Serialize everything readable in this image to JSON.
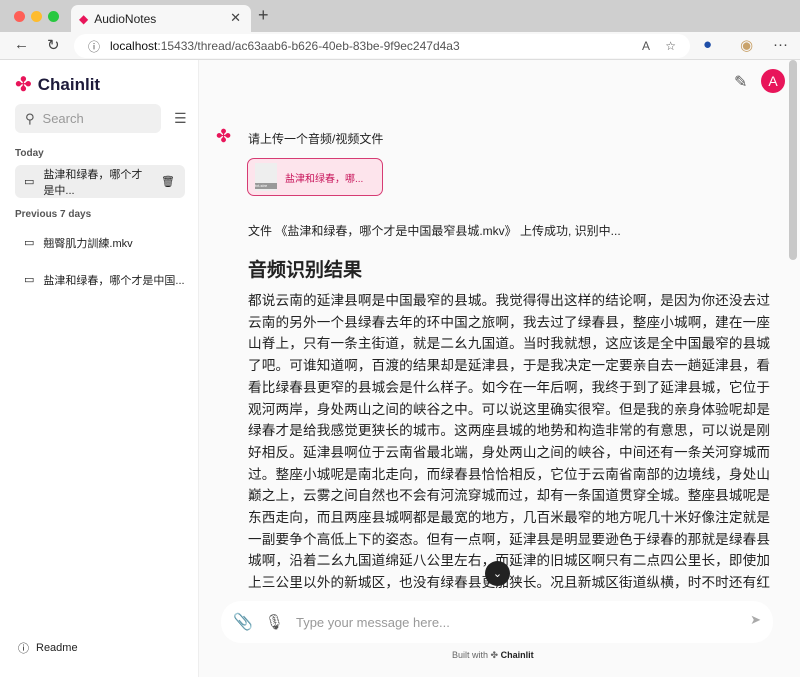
{
  "browser": {
    "tab_title": "AudioNotes",
    "url_host": "localhost",
    "url_rest": ":15433/thread/ac63aab6-b626-40eb-83be-9f9ec247d4a3"
  },
  "sidebar": {
    "brand": "Chainlit",
    "search_placeholder": "Search",
    "today_label": "Today",
    "prev_label": "Previous 7 days",
    "today_items": [
      {
        "label": "盐津和绿春，哪个才是中..."
      }
    ],
    "prev_items": [
      {
        "label": "翹臀肌力訓練.mkv"
      },
      {
        "label": "盐津和绿春，哪个才是中国..."
      }
    ],
    "readme": "Readme"
  },
  "header": {
    "avatar": "A"
  },
  "chat": {
    "prompt": "请上传一个音频/视频文件",
    "file_chip": "盐津和绿春，哪...",
    "file_thumb": "txt-stre",
    "upload_status": "文件 《盐津和绿春，哪个才是中国最窄县城.mkv》 上传成功, 识别中...",
    "result_heading": "音频识别结果",
    "result_text": "都说云南的延津县啊是中国最窄的县城。我觉得得出这样的结论啊，是因为你还没去过云南的另外一个县绿春去年的环中国之旅啊，我去过了绿春县，整座小城啊，建在一座山脊上，只有一条主街道，就是二幺九国道。当时我就想，这应该是全中国最窄的县城了吧。可谁知道啊，百渡的结果却是延津县，于是我决定一定要亲自去一趟延津县，看看比绿春县更窄的县城会是什么样子。如今在一年后啊，我终于到了延津县城，它位于观河两岸，身处两山之间的峡谷之中。可以说这里确实很窄。但是我的亲身体验呢却是绿春才是给我感觉更狭长的城市。这两座县城的地势和构造非常的有意思，可以说是刚好相反。延津县啊位于云南省最北端，身处两山之间的峡谷，中间还有一条关河穿城而过。整座小城呢是南北走向，而绿春县恰恰相反，它位于云南省南部的边境线，身处山巅之上，云雾之间自然也不会有河流穿城而过，却有一条国道贯穿全城。整座县城呢是东西走向，而且两座县城啊都是最宽的地方，几百米最窄的地方呢几十米好像注定就是一副要争个高低上下的姿态。但有一点啊，延津县是明显要逊色于绿春的那就是绿春县城啊，沿着二幺九国道绵延八公里左右，而延津的旧城区啊只有二点四公里长，即使加上三公里以外的新城区，也没有绿春县更加狭长。况且新城区街道纵横，时不时还有红绿灯，已经完全没有了狭窄的感觉。要知道绿春县城内啊可是几乎看不到红绿灯踪影的。在绿春县城街道上最多的车就是这样的，五菱公交车几乎是一辆，接着一辆是人们出行的主要方式。而延津县呢虽然也有类似的小型公交车，而数量上完全不是一个量级，似乎人们啊还是习惯于开车出门。城内很多的单行道，显然是为了更方便人们开车，这也从另一个侧面反映出啊，绿春县显然是要更为狭长。但是啊如果你非起了无人机，就会发现，由于"
  },
  "composer": {
    "placeholder": "Type your message here...",
    "built_with": "Built with",
    "brand": "Chainlit"
  },
  "colors": {
    "accent": "#e8155a",
    "chip_bg": "#fde4ec"
  }
}
